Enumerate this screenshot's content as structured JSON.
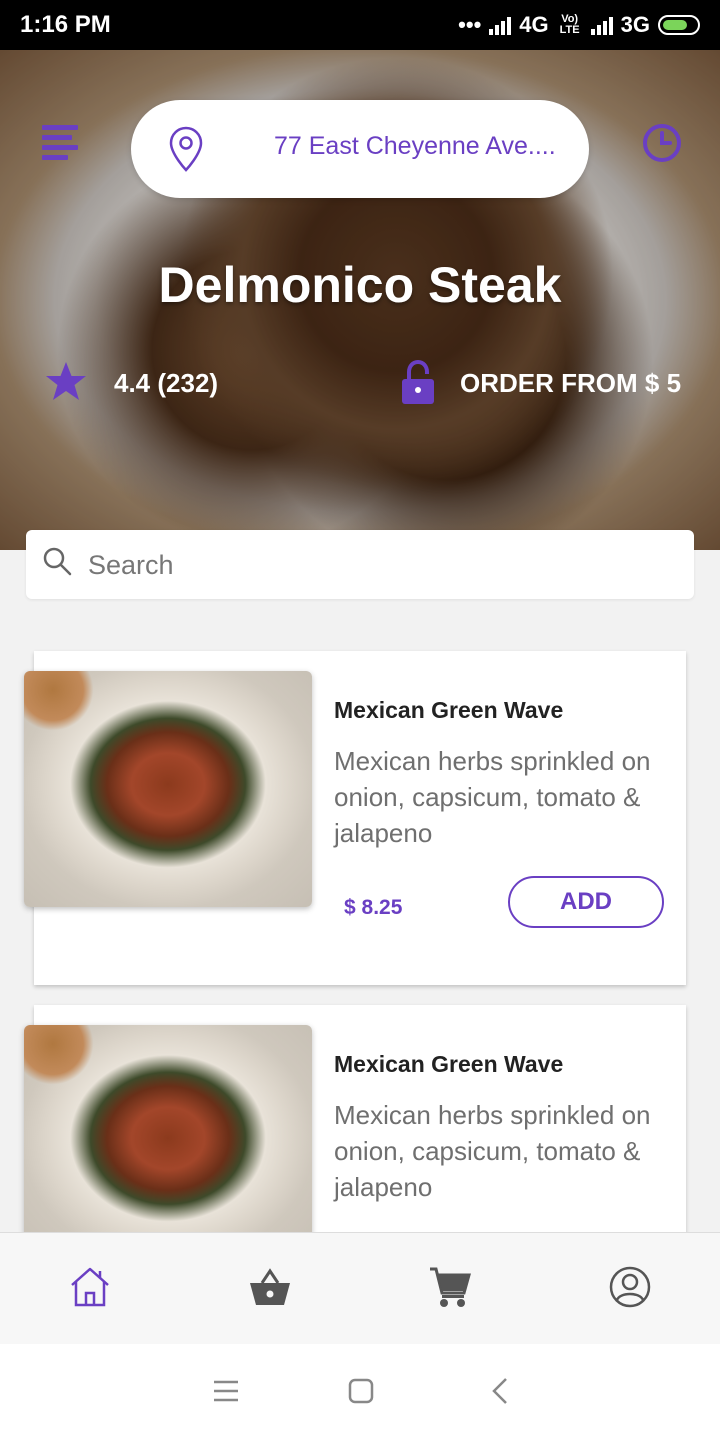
{
  "status_bar": {
    "time": "1:16 PM",
    "network_4g": "4G",
    "volte": "Vo) LTE",
    "network_3g": "3G"
  },
  "header": {
    "address": "77 East Cheyenne Ave....",
    "restaurant_name": "Delmonico Steak",
    "rating": "4.4 (232)",
    "order_from": "ORDER FROM $ 5"
  },
  "search": {
    "placeholder": "Search"
  },
  "menu_items": [
    {
      "name": "Mexican Green Wave",
      "description": "Mexican herbs sprinkled on onion, capsicum, tomato & jalapeno",
      "price": "$ 8.25",
      "add_label": "ADD"
    },
    {
      "name": "Mexican Green Wave",
      "description": "Mexican herbs sprinkled on onion, capsicum, tomato & jalapeno"
    }
  ],
  "bottom_nav": [
    {
      "icon": "home-icon",
      "active": true
    },
    {
      "icon": "basket-icon",
      "active": false
    },
    {
      "icon": "cart-icon",
      "active": false
    },
    {
      "icon": "profile-icon",
      "active": false
    }
  ],
  "colors": {
    "accent": "#6a3fc3",
    "nav_inactive": "#555555",
    "price": "#6a3fc3"
  }
}
